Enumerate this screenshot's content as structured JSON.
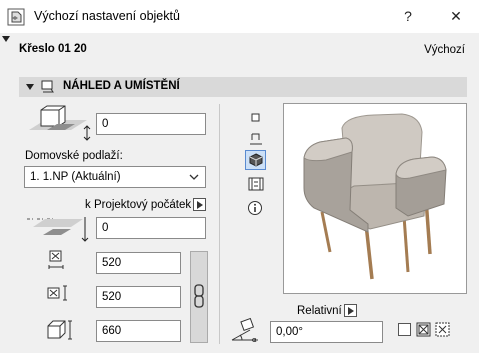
{
  "window": {
    "title": "Výchozí nastavení objektů",
    "help_label": "?",
    "close_label": "✕"
  },
  "header": {
    "object_name": "Křeslo 01 20",
    "mode_label": "Výchozí"
  },
  "section": {
    "title": "NÁHLED A UMÍSTĚNÍ"
  },
  "placement": {
    "elevation_value": "0",
    "home_story_label": "Domovské podlaží:",
    "home_story_value": "1. 1.NP (Aktuální)",
    "reference_label": "k Projektový počátek",
    "reference_value": "0",
    "width_value": "520",
    "depth_value": "520",
    "height_value": "660"
  },
  "preview": {
    "relative_label": "Relativní",
    "rotation_value": "0,00°"
  },
  "icons": {
    "collapse": "triangle-down-icon",
    "view_2d": "2d-view-icon",
    "view_section": "section-view-icon",
    "view_3d": "3d-view-icon",
    "view_list": "list-view-icon",
    "info": "info-icon",
    "link": "chain-link-icon"
  }
}
